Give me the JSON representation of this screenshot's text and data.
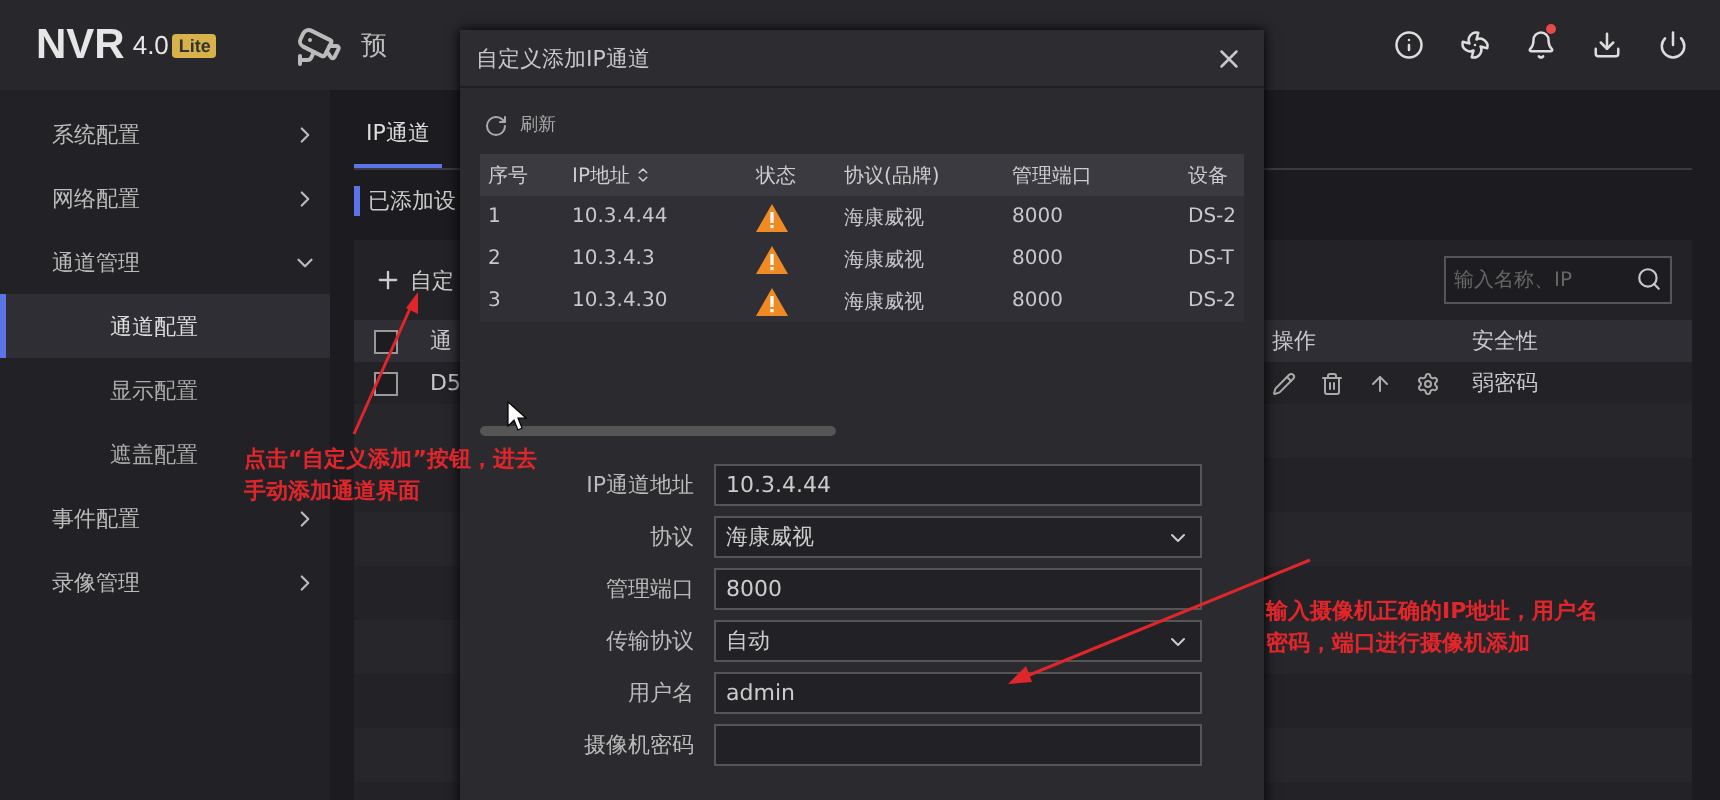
{
  "header": {
    "logo": "NVR",
    "version": "4.0",
    "edition": "Lite",
    "nav": [
      {
        "label": "预",
        "selected": false
      }
    ],
    "notification_dot": true
  },
  "sidebar": {
    "items": [
      {
        "label": "系统配置",
        "expanded": false
      },
      {
        "label": "网络配置",
        "expanded": false
      },
      {
        "label": "通道管理",
        "expanded": true,
        "children": [
          {
            "label": "通道配置",
            "selected": true
          },
          {
            "label": "显示配置",
            "selected": false
          },
          {
            "label": "遮盖配置",
            "selected": false
          }
        ]
      },
      {
        "label": "事件配置",
        "expanded": false
      },
      {
        "label": "录像管理",
        "expanded": false
      }
    ]
  },
  "main": {
    "tabs": [
      {
        "label": "IP通道",
        "selected": true
      }
    ],
    "section_title": "已添加设",
    "add_button": "自定",
    "search": {
      "placeholder": "输入名称、IP"
    },
    "table": {
      "columns": [
        "通",
        "操作",
        "安全性"
      ],
      "all_checked": false,
      "rows": [
        {
          "name": "D5",
          "checked": false,
          "security": "弱密码"
        }
      ]
    }
  },
  "dialog": {
    "title": "自定义添加IP通道",
    "refresh": "刷新",
    "columns": [
      "序号",
      "IP地址",
      "状态",
      "协议(品牌)",
      "管理端口",
      "设备"
    ],
    "rows": [
      {
        "index": "1",
        "ip": "10.3.4.44",
        "warning": true,
        "protocol": "海康威视",
        "port": "8000",
        "device_type": "DS-2"
      },
      {
        "index": "2",
        "ip": "10.3.4.3",
        "warning": true,
        "protocol": "海康威视",
        "port": "8000",
        "device_type": "DS-T"
      },
      {
        "index": "3",
        "ip": "10.3.4.30",
        "warning": true,
        "protocol": "海康威视",
        "port": "8000",
        "device_type": "DS-2"
      }
    ],
    "form": [
      {
        "label": "IP通道地址",
        "value": "10.3.4.44",
        "kind": "text"
      },
      {
        "label": "协议",
        "value": "海康威视",
        "kind": "select"
      },
      {
        "label": "管理端口",
        "value": "8000",
        "kind": "text"
      },
      {
        "label": "传输协议",
        "value": "自动",
        "kind": "select"
      },
      {
        "label": "用户名",
        "value": "admin",
        "kind": "text"
      },
      {
        "label": "摄像机密码",
        "kind": "text"
      }
    ]
  },
  "annotations": [
    {
      "lines": [
        "点击“自定义添加”按钮，进去",
        "手动添加通道界面"
      ]
    },
    {
      "lines": [
        "输入摄像机正确的IP地址，用户名",
        "密码，端口进行摄像机添加"
      ]
    }
  ]
}
